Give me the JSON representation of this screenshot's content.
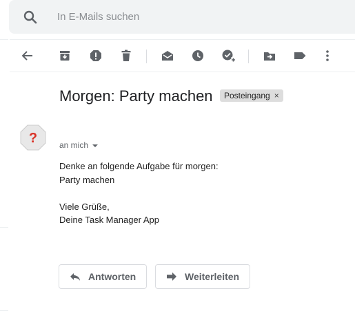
{
  "search": {
    "placeholder": "In E-Mails suchen"
  },
  "toolbar": {
    "icons": [
      "back-arrow-icon",
      "archive-icon",
      "report-spam-icon",
      "delete-icon",
      "mark-unread-icon",
      "snooze-icon",
      "add-task-icon",
      "move-to-icon",
      "label-icon",
      "more-vert-icon"
    ]
  },
  "email": {
    "subject": "Morgen: Party machen",
    "label": "Posteingang",
    "label_close": "×",
    "sender": "an mich",
    "body_lines": [
      "Denke an folgende Aufgabe für morgen:",
      "Party machen",
      "",
      "Viele Grüße,",
      "Deine Task Manager App"
    ],
    "avatar_glyph": "?"
  },
  "actions": {
    "reply_label": "Antworten",
    "forward_label": "Weiterleiten"
  },
  "colors": {
    "accent": "#5f6368",
    "avatar_bg": "#e8e8e8",
    "avatar_glyph": "#d93025"
  }
}
